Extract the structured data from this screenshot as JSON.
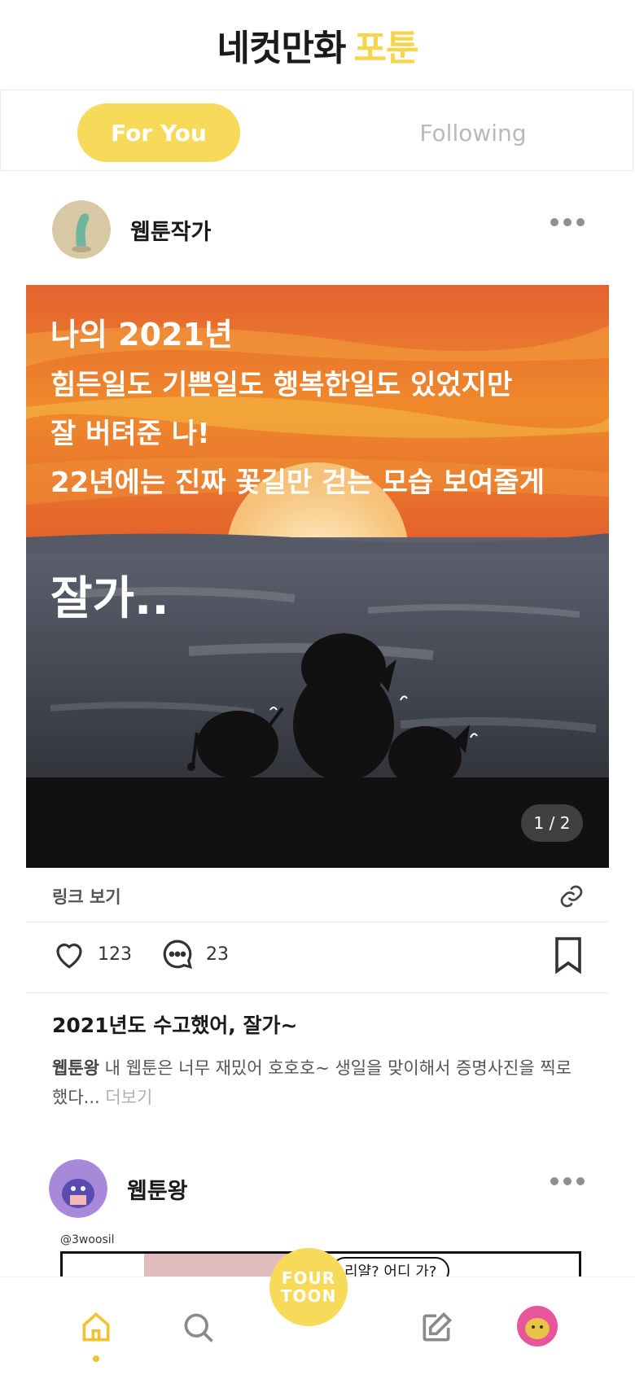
{
  "header": {
    "logo_part1": "네컷만화",
    "logo_part2": "포툰"
  },
  "tabs": [
    {
      "label": "For You",
      "active": true
    },
    {
      "label": "Following",
      "active": false
    }
  ],
  "post1": {
    "author": "웹툰작가",
    "image": {
      "lines": [
        "나의 2021년",
        "힘든일도 기쁜일도 행복한일도 있었지만",
        "잘 버텨준 나!",
        "22년에는 진짜 꽃길만 걷는 모습 보여줄게"
      ],
      "shout": "잘가..",
      "page_indicator": "1 / 2"
    },
    "link_label": "링크 보기",
    "likes": "123",
    "comments": "23",
    "title": "2021년도 수고했어, 잘가~",
    "caption_author": "웹툰왕",
    "caption_text": "내 웹툰은 너무 재밌어 호호호~ 생일을 맞이해서 증명사진을 찍로 했다...",
    "caption_more": "더보기"
  },
  "post2": {
    "author": "웹툰왕",
    "image_watermark": "@3woosil",
    "image_bubble": "리얄? 어디 가?"
  },
  "fab": {
    "line1": "FOUR",
    "line2": "TOON"
  },
  "colors": {
    "accent": "#F8DA5A",
    "inactive": "#B9B9B9"
  },
  "nav": [
    "home-icon",
    "search-icon",
    "write-icon",
    "profile-avatar"
  ]
}
